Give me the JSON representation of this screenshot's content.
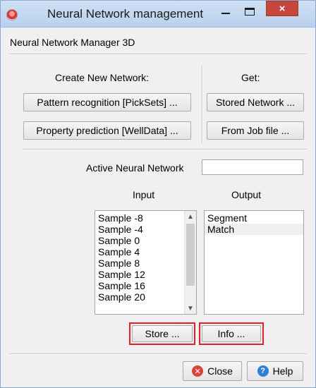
{
  "window": {
    "title": "Neural Network management",
    "subtitle": "Neural Network Manager 3D",
    "minimize_glyph": "",
    "close_glyph": "×"
  },
  "create": {
    "heading": "Create New Network:",
    "pattern_button": "Pattern recognition [PickSets] ...",
    "property_button": "Property prediction [WellData] ..."
  },
  "get": {
    "heading": "Get:",
    "stored_button": "Stored Network ...",
    "jobfile_button": "From Job file ..."
  },
  "active": {
    "label": "Active Neural Network",
    "value": ""
  },
  "input": {
    "label": "Input",
    "items": [
      "Sample -8",
      "Sample -4",
      "Sample 0",
      "Sample 4",
      "Sample 8",
      "Sample 12",
      "Sample 16",
      "Sample 20"
    ]
  },
  "output": {
    "label": "Output",
    "items": [
      "Segment",
      "Match"
    ]
  },
  "buttons": {
    "store": "Store ...",
    "info": "Info ...",
    "close": "Close",
    "help": "Help"
  },
  "icons": {
    "close_icon": "x-circle",
    "help_icon": "question-circle",
    "up_arrow": "^",
    "down_arrow": "v"
  },
  "colors": {
    "highlight": "#e0202a",
    "close_accent": "#c7453a"
  }
}
